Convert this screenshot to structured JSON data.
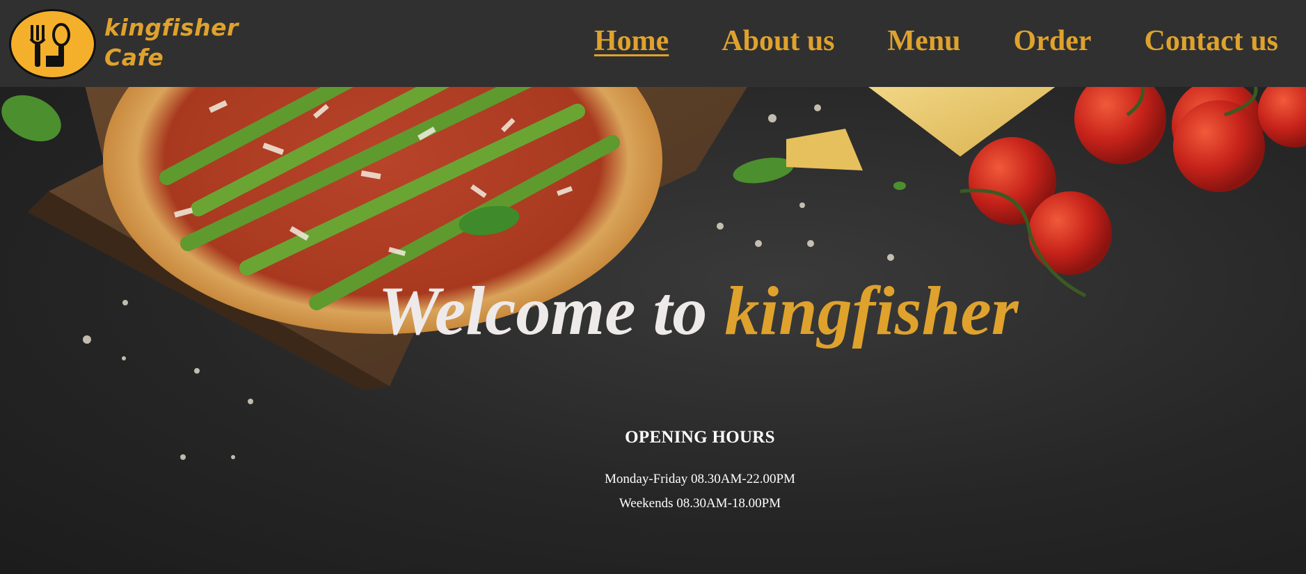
{
  "brand": {
    "line1": "kingfisher",
    "line2": "Cafe"
  },
  "nav": {
    "items": [
      {
        "label": "Home",
        "active": true
      },
      {
        "label": "About us",
        "active": false
      },
      {
        "label": "Menu",
        "active": false
      },
      {
        "label": "Order",
        "active": false
      },
      {
        "label": "Contact us",
        "active": false
      }
    ]
  },
  "hero": {
    "welcome_prefix": "Welcome to",
    "welcome_highlight": "kingfisher"
  },
  "hours": {
    "title": "OPENING HOURS",
    "weekdays": "Monday-Friday 08.30AM-22.00PM",
    "weekends": "Weekends 08.30AM-18.00PM"
  },
  "colors": {
    "accent": "#dfa22d",
    "header_bg": "#303030",
    "logo_bg": "#f4b02a"
  }
}
